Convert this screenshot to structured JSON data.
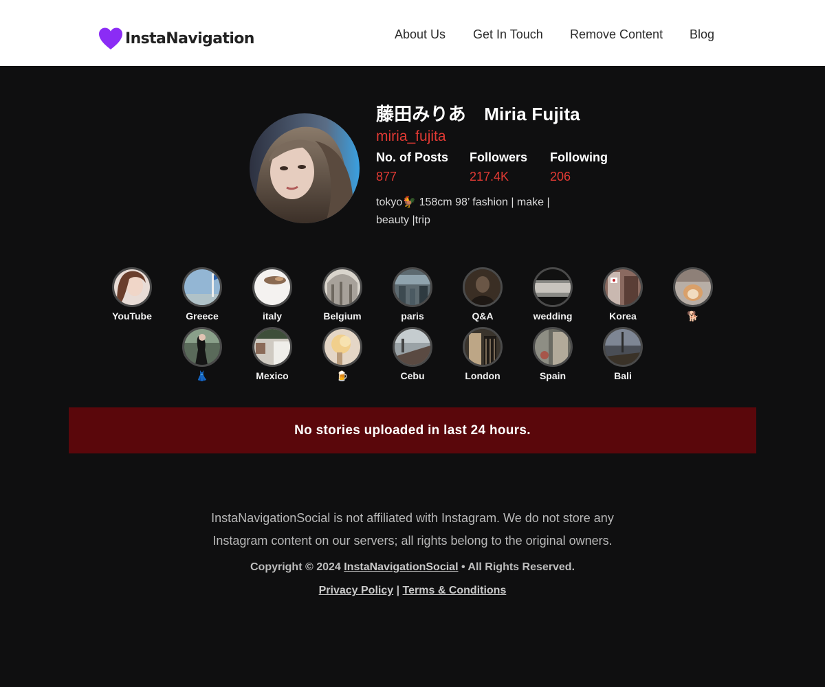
{
  "header": {
    "logo_text": "InstaNavigation",
    "nav": [
      {
        "label": "About Us"
      },
      {
        "label": "Get In Touch"
      },
      {
        "label": "Remove Content"
      },
      {
        "label": "Blog"
      }
    ]
  },
  "profile": {
    "full_name": "藤田みりあ　Miria Fujita",
    "username": "miria_fujita",
    "stats": [
      {
        "label": "No. of Posts",
        "value": "877"
      },
      {
        "label": "Followers",
        "value": "217.4K"
      },
      {
        "label": "Following",
        "value": "206"
      }
    ],
    "bio_line1": "tokyo🐓 158cm 98’ fashion | make |",
    "bio_line2": "beauty |trip"
  },
  "highlights": [
    {
      "label": "YouTube",
      "icon": "highlight-thumbnail"
    },
    {
      "label": "Greece",
      "icon": "highlight-thumbnail"
    },
    {
      "label": "italy",
      "icon": "highlight-thumbnail"
    },
    {
      "label": "Belgium",
      "icon": "highlight-thumbnail"
    },
    {
      "label": "paris",
      "icon": "highlight-thumbnail"
    },
    {
      "label": "Q&A",
      "icon": "highlight-thumbnail"
    },
    {
      "label": "wedding",
      "icon": "highlight-thumbnail"
    },
    {
      "label": "Korea",
      "icon": "highlight-thumbnail"
    },
    {
      "label": "🐕",
      "icon": "highlight-thumbnail"
    },
    {
      "label": "👗",
      "icon": "highlight-thumbnail"
    },
    {
      "label": "Mexico",
      "icon": "highlight-thumbnail"
    },
    {
      "label": "🍺",
      "icon": "highlight-thumbnail"
    },
    {
      "label": "Cebu",
      "icon": "highlight-thumbnail"
    },
    {
      "label": "London",
      "icon": "highlight-thumbnail"
    },
    {
      "label": "Spain",
      "icon": "highlight-thumbnail"
    },
    {
      "label": "Bali",
      "icon": "highlight-thumbnail"
    }
  ],
  "notice": "No stories uploaded in last 24 hours.",
  "footer": {
    "disclaimer_line1": "InstaNavigationSocial is not affiliated with Instagram. We do not store any",
    "disclaimer_line2": "Instagram content on our servers; all rights belong to the original owners.",
    "copyright_prefix": "Copyright © 2024 ",
    "copyright_link": "InstaNavigationSocial",
    "copyright_suffix": " • All Rights Reserved.",
    "privacy_policy": "Privacy Policy",
    "separator": "|",
    "terms": "Terms & Conditions"
  },
  "colors": {
    "accent_red": "#e23a34",
    "logo_purple": "#8b2cf5",
    "notice_bg": "#5a070b",
    "page_bg": "#0f0f10"
  }
}
